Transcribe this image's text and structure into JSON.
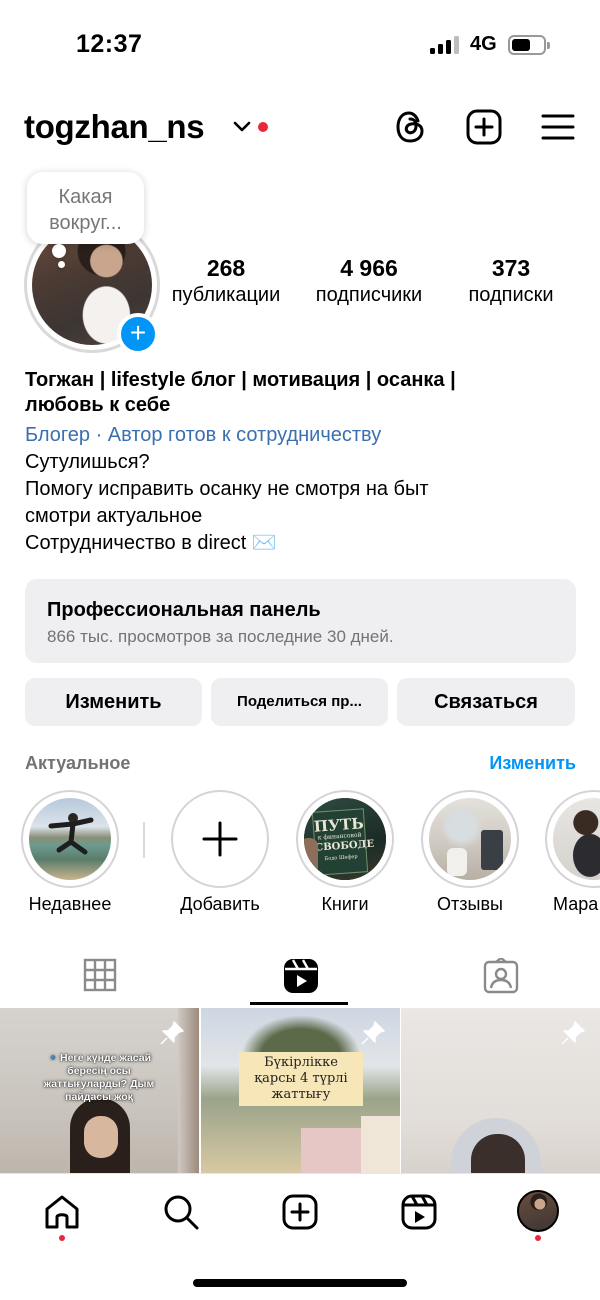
{
  "status_bar": {
    "time": "12:37",
    "network": "4G",
    "signal_bars_active": 3,
    "signal_bars_total": 4
  },
  "header": {
    "username": "togzhan_ns",
    "has_notification_dot": true
  },
  "tooltip": {
    "text_line1": "Какая",
    "text_line2": "вокруг..."
  },
  "stats": [
    {
      "value": "268",
      "label": "публикации"
    },
    {
      "value": "4 966",
      "label": "подписчики"
    },
    {
      "value": "373",
      "label": "подписки"
    }
  ],
  "bio": {
    "name_line1": "Тогжан | lifestyle блог | мотивация | осанка |",
    "name_line2": "любовь к себе",
    "category": "Блогер · Автор готов к сотрудничеству",
    "lines": [
      "Сутулишься?",
      "Помогу исправить осанку не смотря на быт",
      "смотри актуальное",
      "Сотрудничество в direct ✉️"
    ]
  },
  "pro_panel": {
    "title": "Профессиональная панель",
    "subtitle": "866 тыс. просмотров за последние 30 дней."
  },
  "buttons": {
    "edit": "Изменить",
    "share": "Поделиться пр...",
    "contact": "Связаться"
  },
  "highlights": {
    "title": "Актуальное",
    "edit": "Изменить",
    "items": [
      {
        "label": "Недавнее"
      },
      {
        "label": "Добавить"
      },
      {
        "label": "Книги",
        "cover_line1": "ПУТЬ",
        "cover_line2": "к финансовой",
        "cover_line3": "СВОБОДЕ",
        "cover_author": "Бодо Шефер"
      },
      {
        "label": "Отзывы"
      },
      {
        "label": "Мара"
      }
    ]
  },
  "grid": [
    {
      "caption": "🔹Неге күнде жасай бересің осы жаттығуларды? Дым пайдасы жоқ",
      "pinned": true
    },
    {
      "caption": "Бүкірлікке қарсы 4 түрлі жаттығу",
      "pinned": true
    },
    {
      "caption": "",
      "pinned": true
    }
  ],
  "colors": {
    "accent": "#0095f6",
    "link": "#3a6fb0",
    "notification": "#e9283b",
    "panel": "#efeff1",
    "muted": "#737373"
  },
  "nav": {
    "items": [
      "home-icon",
      "search-icon",
      "create-icon",
      "reels-icon",
      "profile-avatar"
    ],
    "dots_on": [
      "home",
      "profile"
    ]
  }
}
